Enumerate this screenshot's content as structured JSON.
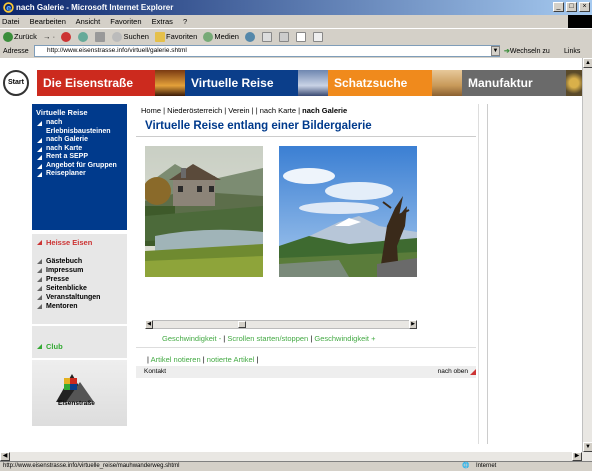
{
  "window": {
    "title": "nach Galerie - Microsoft Internet Explorer",
    "controls": [
      "_",
      "□",
      "×"
    ]
  },
  "menu": [
    "Datei",
    "Bearbeiten",
    "Ansicht",
    "Favoriten",
    "Extras",
    "?"
  ],
  "toolbar": {
    "back": "Zurück",
    "search": "Suchen",
    "favorites": "Favoriten",
    "media": "Medien"
  },
  "address": {
    "label": "Adresse",
    "url": "http://www.eisenstrasse.info/virtuell/galerie.shtml",
    "go": "Wechseln zu",
    "links": "Links"
  },
  "site": {
    "start": "Start",
    "nav": [
      "Die Eisenstraße",
      "Virtuelle Reise",
      "Schatzsuche",
      "Manufaktur"
    ],
    "leftnav": {
      "title": "Virtuelle Reise",
      "items": [
        "nach Erlebnisbausteinen",
        "nach Galerie",
        "nach Karte",
        "Rent a SEPP",
        "Angebot für Gruppen",
        "Reiseplaner"
      ]
    },
    "heisse": {
      "title": "Heisse Eisen",
      "items": [
        "Gästebuch",
        "Impressum",
        "Presse",
        "Seitenblicke",
        "Veranstaltungen",
        "Mentoren"
      ]
    },
    "club": "Club",
    "logo_text": "Eisenstraße"
  },
  "main": {
    "breadcrumb": {
      "home": "Home",
      "region": "Niederösterreich",
      "verein": "Verein",
      "karte": "nach Karte",
      "current": "nach Galerie"
    },
    "title": "Virtuelle Reise entlang einer Bildergalerie",
    "speed_minus": "Geschwindigkeit -",
    "scroll_toggle": "Scrollen starten/stoppen",
    "speed_plus": "Geschwindigkeit +",
    "artikel_notieren": "Artikel notieren",
    "notierte_artikel": "notierte Artikel",
    "kontakt": "Kontakt",
    "nach_oben": "nach oben"
  },
  "status": {
    "url": "http://www.eisenstrasse.info/virtuelle_reise/mauhwanderweg.shtml",
    "zone": "Internet"
  },
  "colors": {
    "nav_red": "#cc2a1e",
    "nav_blue": "#0b3e8a",
    "nav_orange": "#f08a1c",
    "nav_gray": "#6a6a6a",
    "leftnav_blue": "#003a8c",
    "title_blue": "#003a8c",
    "link_green": "#44aa44",
    "accent_red": "#cc3333"
  }
}
